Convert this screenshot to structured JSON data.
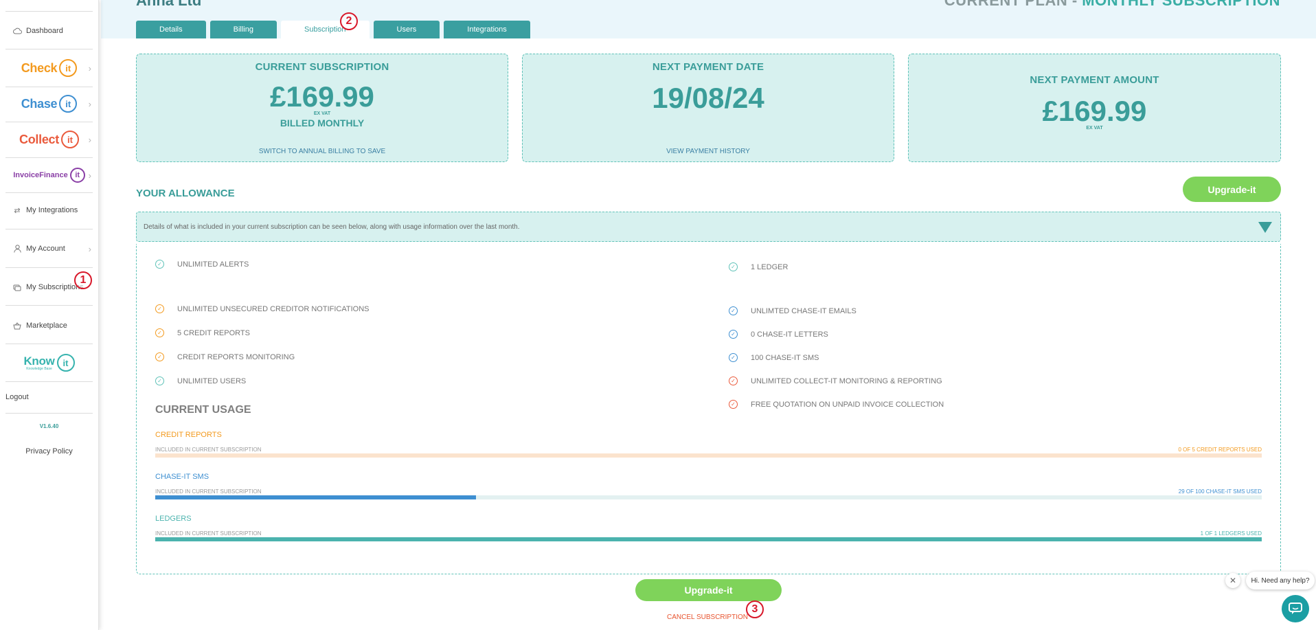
{
  "sidebar": {
    "dashboard": "Dashboard",
    "brands": [
      {
        "name": "Check",
        "circle": "it",
        "color": "#f39a1e"
      },
      {
        "name": "Chase",
        "circle": "it",
        "color": "#3e8fd1"
      },
      {
        "name": "Collect",
        "circle": "it",
        "color": "#ea5a3c"
      },
      {
        "name": "InvoiceFinance",
        "circle": "it",
        "color": "#8a3fa6"
      }
    ],
    "integrations": "My Integrations",
    "account": "My Account",
    "subscriptions": "My Subscriptions",
    "marketplace": "Marketplace",
    "knowit": {
      "name": "Know",
      "circle": "it",
      "sub": "Knowledge Base",
      "color": "#36b3ae"
    },
    "logout": "Logout",
    "version": "V1.6.40",
    "privacy": "Privacy Policy"
  },
  "header": {
    "title_left": "Anna Ltd",
    "title_right_prefix": "CURRENT PLAN - ",
    "title_right_value": "MONTHLY SUBSCRIPTION"
  },
  "tabs": [
    "Details",
    "Billing",
    "Subscription",
    "Users",
    "Integrations"
  ],
  "cards": {
    "current": {
      "title": "CURRENT SUBSCRIPTION",
      "amount": "£169.99",
      "vat": "EX VAT",
      "billed": "BILLED MONTHLY",
      "link": "SWITCH TO ANNUAL BILLING TO SAVE"
    },
    "next_date": {
      "title": "NEXT PAYMENT DATE",
      "date": "19/08/24",
      "link": "VIEW PAYMENT HISTORY"
    },
    "next_amount": {
      "title": "NEXT PAYMENT AMOUNT",
      "amount": "£169.99",
      "vat": "EX VAT"
    }
  },
  "allowance": {
    "title": "YOUR ALLOWANCE",
    "upgrade": "Upgrade-it",
    "description": "Details of what is included in your current subscription can be seen below, along with usage information over the last month.",
    "left_features": [
      {
        "text": "UNLIMITED ALERTS",
        "color": "#5fc2b8"
      },
      {
        "text": "UNLIMITED UNSECURED CREDITOR NOTIFICATIONS",
        "color": "#f39a1e"
      },
      {
        "text": "5 CREDIT REPORTS",
        "color": "#f39a1e"
      },
      {
        "text": "CREDIT REPORTS MONITORING",
        "color": "#f39a1e"
      },
      {
        "text": "UNLIMITED USERS",
        "color": "#5fc2b8"
      }
    ],
    "right_features": [
      {
        "text": "1 LEDGER",
        "color": "#5fc2b8"
      },
      {
        "text": "UNLIMTED CHASE-IT EMAILS",
        "color": "#3e8fd1"
      },
      {
        "text": "0 CHASE-IT LETTERS",
        "color": "#3e8fd1"
      },
      {
        "text": "100 CHASE-IT SMS",
        "color": "#3e8fd1"
      },
      {
        "text": "UNLIMITED COLLECT-IT MONITORING & REPORTING",
        "color": "#ea5a3c"
      },
      {
        "text": "FREE QUOTATION ON UNPAID INVOICE COLLECTION",
        "color": "#ea5a3c"
      }
    ]
  },
  "usage": {
    "title": "CURRENT USAGE",
    "items": [
      {
        "label": "CREDIT REPORTS",
        "sub": "INCLUDED IN CURRENT SUBSCRIPTION",
        "right": "0 OF 5 CREDIT REPORTS USED",
        "fraction": 0.0,
        "color": "#f39a1e",
        "track": "#fbe3cd"
      },
      {
        "label": "CHASE-IT SMS",
        "sub": "INCLUDED IN CURRENT SUBSCRIPTION",
        "right": "29 OF 100 CHASE-IT SMS USED",
        "fraction": 0.29,
        "color": "#3e8fd1",
        "track": "#e3f1f1"
      },
      {
        "label": "LEDGERS",
        "sub": "INCLUDED IN CURRENT SUBSCRIPTION",
        "right": "1 OF 1 LEDGERS USED",
        "fraction": 1.0,
        "color": "#4bb3ae",
        "track": "#d7f1ef"
      }
    ]
  },
  "actions": {
    "upgrade": "Upgrade-it",
    "cancel": "CANCEL SUBSCRIPTION"
  },
  "markers": [
    "1",
    "2",
    "3"
  ],
  "help": {
    "text": "Hi. Need any help?",
    "close": "✕"
  }
}
